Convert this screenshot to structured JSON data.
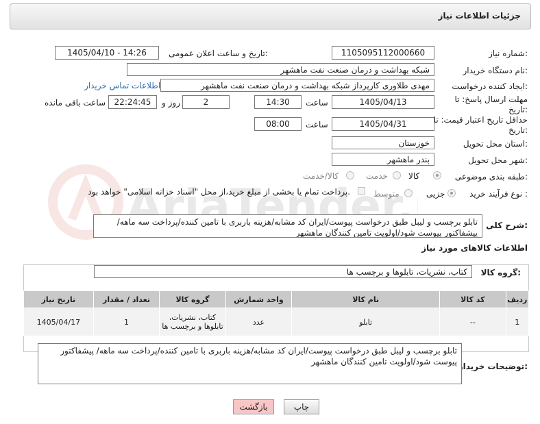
{
  "header": {
    "title": "جزئیات اطلاعات نیاز"
  },
  "form": {
    "need_number_label": "شماره نیاز:",
    "need_number": "1105095112000660",
    "announce_label": "تاریخ و ساعت اعلان عمومی:",
    "announce_value": "1405/04/10 - 14:26",
    "buyer_org_label": "نام دستگاه خریدار:",
    "buyer_org": "شبکه بهداشت و درمان صنعت نفت ماهشهر",
    "creator_label": "ایجاد کننده درخواست:",
    "creator": "مهدی طلاوری کارپرداز شبکه بهداشت و درمان صنعت نفت ماهشهر",
    "contact_link": "اطلاعات تماس خریدار",
    "deadline_label": "مهلت ارسال پاسخ: تا تاریخ:",
    "deadline_date": "1405/04/13",
    "hour_label": "ساعت",
    "deadline_time": "14:30",
    "days_value": "2",
    "days_label": "روز و",
    "remaining_time": "22:24:45",
    "remaining_label": "ساعت باقی مانده",
    "validity_label": "حداقل تاریخ اعتبار قیمت: تا تاریخ:",
    "validity_date": "1405/04/31",
    "validity_hour_label": "ساعت",
    "validity_time": "08:00",
    "province_label": "استان محل تحویل:",
    "province": "خوزستان",
    "city_label": "شهر محل تحویل:",
    "city": "بندر ماهشهر",
    "category_label": "طبقه بندی موضوعی:",
    "category_options": [
      "کالا",
      "خدمت",
      "کالا/خدمت"
    ],
    "category_selected": "کالا",
    "process_label": "نوع فرآیند خرید :",
    "process_options": [
      "جزیی",
      "متوسط"
    ],
    "process_selected": "جزیی",
    "payment_note": "پرداخت تمام یا بخشی از مبلغ خرید،از محل \"اسناد خزانه اسلامی\" خواهد بود."
  },
  "summary": {
    "label": "شرح کلی نیاز:",
    "text": "تابلو برچسب و لیبل طبق درخواست پیوست/ایران کد مشابه/هزینه باربری با تامین کننده/پرداخت سه ماهه/ پیشفاکتور پیوست شود/اولویت تامین کنندگان ماهشهر"
  },
  "goods": {
    "section_title": "اطلاعات کالاهای مورد نیاز",
    "group_label": "گروه کالا:",
    "group_value": "کتاب، نشریات، تابلوها و برچسب ها",
    "columns": [
      "ردیف",
      "کد کالا",
      "نام کالا",
      "واحد شمارش",
      "گروه کالا",
      "تعداد / مقدار",
      "تاریخ نیاز"
    ],
    "rows": [
      {
        "row": "1",
        "code": "--",
        "name": "تابلو",
        "unit": "عدد",
        "group": "کتاب، نشریات، تابلوها و برچسب ها",
        "qty": "1",
        "date": "1405/04/17"
      }
    ]
  },
  "buyer_notes": {
    "label": "توضیحات خریدار:",
    "text": "تابلو برچسب و لیبل طبق درخواست پیوست/ایران کد مشابه/هزینه باربری با تامین کننده/پرداخت سه ماهه/ پیشفاکتور پیوست شود/اولویت تامین کنندگان ماهشهر"
  },
  "buttons": {
    "back": "بازگشت",
    "print": "چاپ"
  },
  "watermark": "AriaTender.net",
  "colors": {
    "link": "#2a6fb5",
    "back_button": "#f7c6c6",
    "table_header": "#c9c9c9"
  }
}
